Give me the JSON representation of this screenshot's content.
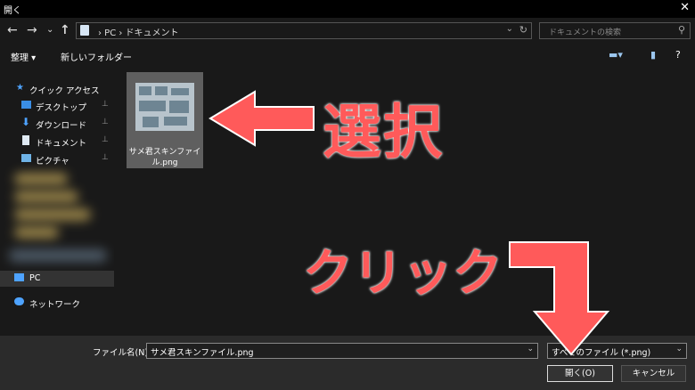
{
  "window": {
    "title": "開く",
    "close_glyph": "✕"
  },
  "nav": {
    "back": "←",
    "forward": "→",
    "recent": "⌄",
    "up": "↑",
    "breadcrumb": "› PC › ドキュメント",
    "search_placeholder": "ドキュメントの検索"
  },
  "toolbar": {
    "organize": "整理 ▾",
    "new_folder": "新しいフォルダー"
  },
  "sidebar": {
    "items": [
      {
        "label": "クイック アクセス",
        "icon": "star-icon"
      },
      {
        "label": "デスクトップ",
        "icon": "desktop-icon"
      },
      {
        "label": "ダウンロード",
        "icon": "download-icon"
      },
      {
        "label": "ドキュメント",
        "icon": "document-icon"
      },
      {
        "label": "ピクチャ",
        "icon": "pictures-icon"
      },
      {
        "label": "PC",
        "icon": "pc-icon"
      },
      {
        "label": "ネットワーク",
        "icon": "network-icon"
      }
    ],
    "pin_glyph": "📌"
  },
  "main": {
    "file": {
      "name": "サメ君スキンファイル.png"
    }
  },
  "bottom": {
    "filename_label": "ファイル名(N):",
    "filename_value": "サメ君スキンファイル.png",
    "filter_value": "すべてのファイル (*.png)",
    "open_button": "開く(O)",
    "cancel_button": "キャンセル"
  },
  "annotations": {
    "select": "選択",
    "click": "クリック"
  },
  "colors": {
    "accent": "#ff5a5a",
    "background": "#191919",
    "bottom_bar": "#2b2b2b"
  }
}
